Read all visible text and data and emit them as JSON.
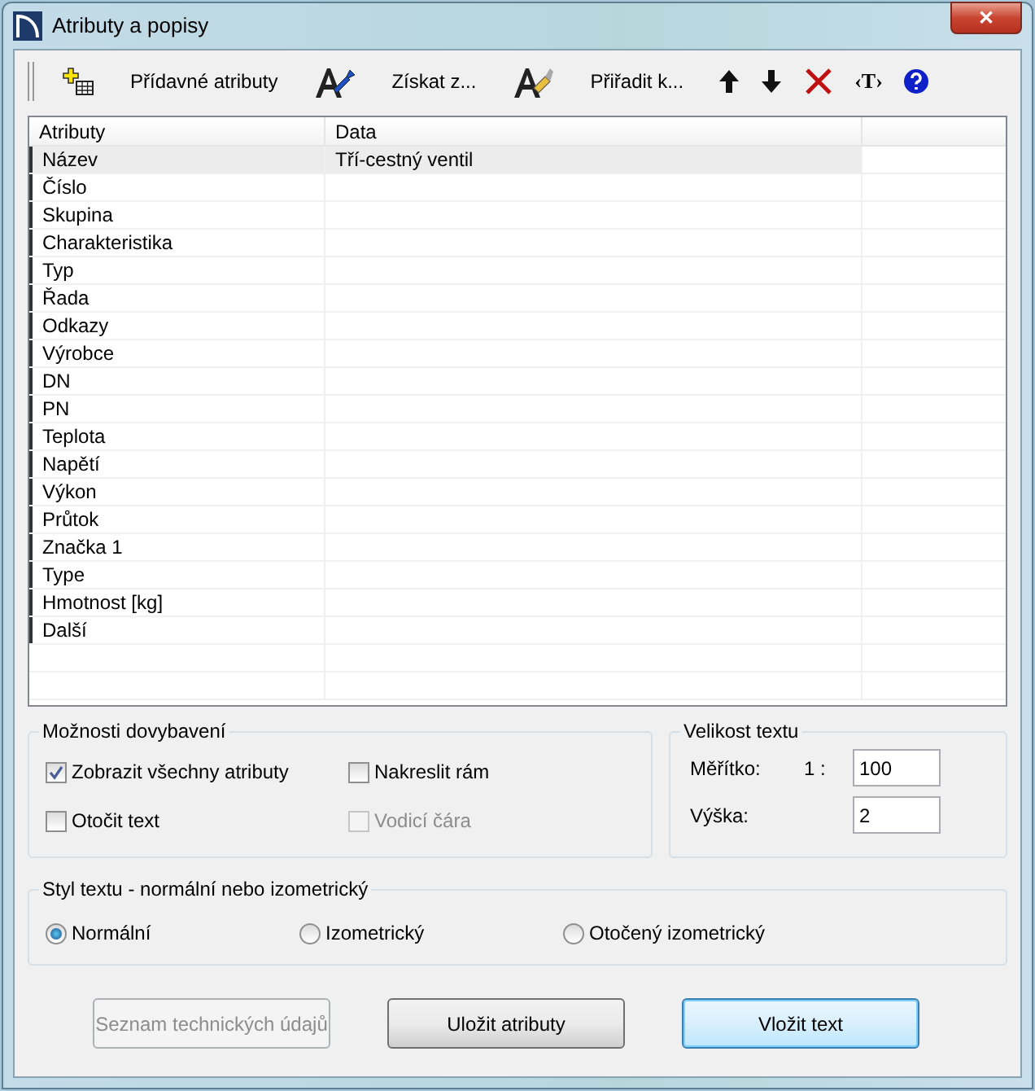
{
  "window": {
    "title": "Atributy a popisy",
    "close_label": "✕"
  },
  "toolbar": [
    {
      "kind": "add"
    },
    {
      "kind": "text",
      "label": "Přídavné atributy"
    },
    {
      "kind": "pick"
    },
    {
      "kind": "text",
      "label": "Získat z..."
    },
    {
      "kind": "assign"
    },
    {
      "kind": "text",
      "label": "Přiřadit k..."
    },
    {
      "kind": "up"
    },
    {
      "kind": "down"
    },
    {
      "kind": "delete"
    },
    {
      "kind": "glyph",
      "label": "‹T›"
    },
    {
      "kind": "help"
    }
  ],
  "table": {
    "columns": [
      "Atributy",
      "Data"
    ],
    "rows": [
      {
        "cells": [
          "Název",
          "Tří-cestný ventil"
        ],
        "selected": true
      },
      {
        "cells": [
          "Číslo",
          ""
        ],
        "selected": false
      },
      {
        "cells": [
          "Skupina",
          ""
        ],
        "selected": false
      },
      {
        "cells": [
          "Charakteristika",
          ""
        ],
        "selected": false
      },
      {
        "cells": [
          "Typ",
          ""
        ],
        "selected": false
      },
      {
        "cells": [
          "Řada",
          ""
        ],
        "selected": false
      },
      {
        "cells": [
          "Odkazy",
          ""
        ],
        "selected": false
      },
      {
        "cells": [
          "Výrobce",
          ""
        ],
        "selected": false
      },
      {
        "cells": [
          "DN",
          ""
        ],
        "selected": false
      },
      {
        "cells": [
          "PN",
          ""
        ],
        "selected": false
      },
      {
        "cells": [
          "Teplota",
          ""
        ],
        "selected": false
      },
      {
        "cells": [
          "Napětí",
          ""
        ],
        "selected": false
      },
      {
        "cells": [
          "Výkon",
          ""
        ],
        "selected": false
      },
      {
        "cells": [
          "Průtok",
          ""
        ],
        "selected": false
      },
      {
        "cells": [
          "Značka 1",
          ""
        ],
        "selected": false
      },
      {
        "cells": [
          "Type",
          ""
        ],
        "selected": false
      },
      {
        "cells": [
          "Hmotnost [kg]",
          ""
        ],
        "selected": false
      },
      {
        "cells": [
          "Další",
          ""
        ],
        "selected": false
      }
    ]
  },
  "options": {
    "title": "Možnosti dovybavení",
    "checkboxes": [
      {
        "label": "Zobrazit všechny atributy",
        "checked": true,
        "disabled": false
      },
      {
        "label": "Nakreslit rám",
        "checked": false,
        "disabled": false
      },
      {
        "label": "Otočit text",
        "checked": false,
        "disabled": false
      },
      {
        "label": "Vodicí čára",
        "checked": false,
        "disabled": true
      }
    ]
  },
  "text_size": {
    "title": "Velikost textu",
    "scale_label": "Měřítko:",
    "scale_prefix": "1 :",
    "scale_value": "100",
    "height_label": "Výška:",
    "height_value": "2"
  },
  "text_style": {
    "title": "Styl textu - normální nebo izometrický",
    "radios": [
      {
        "label": "Normální",
        "selected": true
      },
      {
        "label": "Izometrický",
        "selected": false
      },
      {
        "label": "Otočený izometrický",
        "selected": false
      }
    ]
  },
  "buttons": [
    {
      "label": "Seznam technických údajů",
      "disabled": true,
      "default": false
    },
    {
      "label": "Uložit atributy",
      "disabled": false,
      "default": false
    },
    {
      "label": "Vložit text",
      "disabled": false,
      "default": true
    }
  ]
}
